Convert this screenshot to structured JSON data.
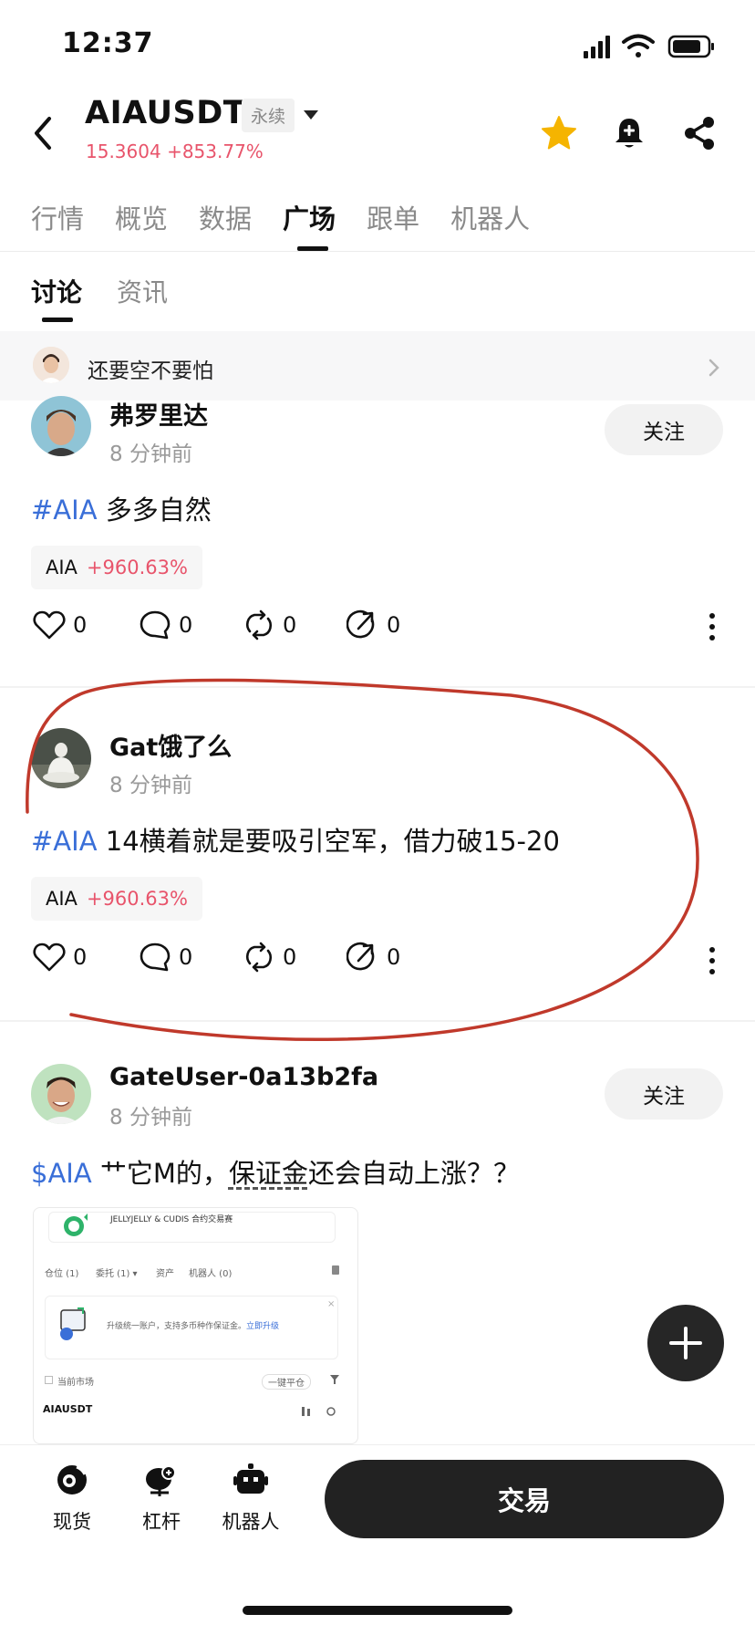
{
  "status_bar": {
    "time": "12:37"
  },
  "header": {
    "pair": "AIAUSDT",
    "type_badge": "永续",
    "price_line": "15.3604 +853.77%"
  },
  "main_tabs": [
    "行情",
    "概览",
    "数据",
    "广场",
    "跟单",
    "机器人"
  ],
  "main_tab_active": "广场",
  "sub_tabs": [
    "讨论",
    "资讯"
  ],
  "sub_tab_active": "讨论",
  "banner": {
    "text": "还要空不要怕"
  },
  "posts": [
    {
      "user": "弗罗里达",
      "time_ago": "8 分钟前",
      "follow_label": "关注",
      "tag": "#AIA",
      "text": "多多自然",
      "coin": {
        "name": "AIA",
        "change": "+960.63%"
      },
      "likes": "0",
      "comments": "0",
      "reposts": "0",
      "shares": "0"
    },
    {
      "user": "Gat饿了么",
      "time_ago": "8 分钟前",
      "tag": "#AIA",
      "text": "14横着就是要吸引空军，借力破15-20",
      "coin": {
        "name": "AIA",
        "change": "+960.63%"
      },
      "likes": "0",
      "comments": "0",
      "reposts": "0",
      "shares": "0"
    },
    {
      "user": "GateUser-0a13b2fa",
      "time_ago": "8 分钟前",
      "follow_label": "关注",
      "tag": "$AIA",
      "text_a": "艹它M的，",
      "text_b": "保证金",
      "text_c": "还会自动上涨？？"
    }
  ],
  "thumbnail": {
    "banner_title": "JELLYJELLY & CUDIS 合约交易赛",
    "tabs": [
      "仓位 (1)",
      "委托 (1) ▾",
      "资产",
      "机器人 (0)"
    ],
    "notice": "升级统一账户，支持多币种作保证金。",
    "notice_link": "立即升级",
    "filter_label": "当前市场",
    "close_all": "一键平仓",
    "pair": "AIAUSDT"
  },
  "bottom_nav": [
    {
      "label": "现货",
      "icon": "spot-icon"
    },
    {
      "label": "杠杆",
      "icon": "margin-icon"
    },
    {
      "label": "机器人",
      "icon": "robot-icon"
    }
  ],
  "trade_button": "交易",
  "colors": {
    "up_red": "#e8546b",
    "tag_blue": "#3a6fd8",
    "star_yellow": "#f5b400",
    "annotation_red": "#c0392b"
  }
}
